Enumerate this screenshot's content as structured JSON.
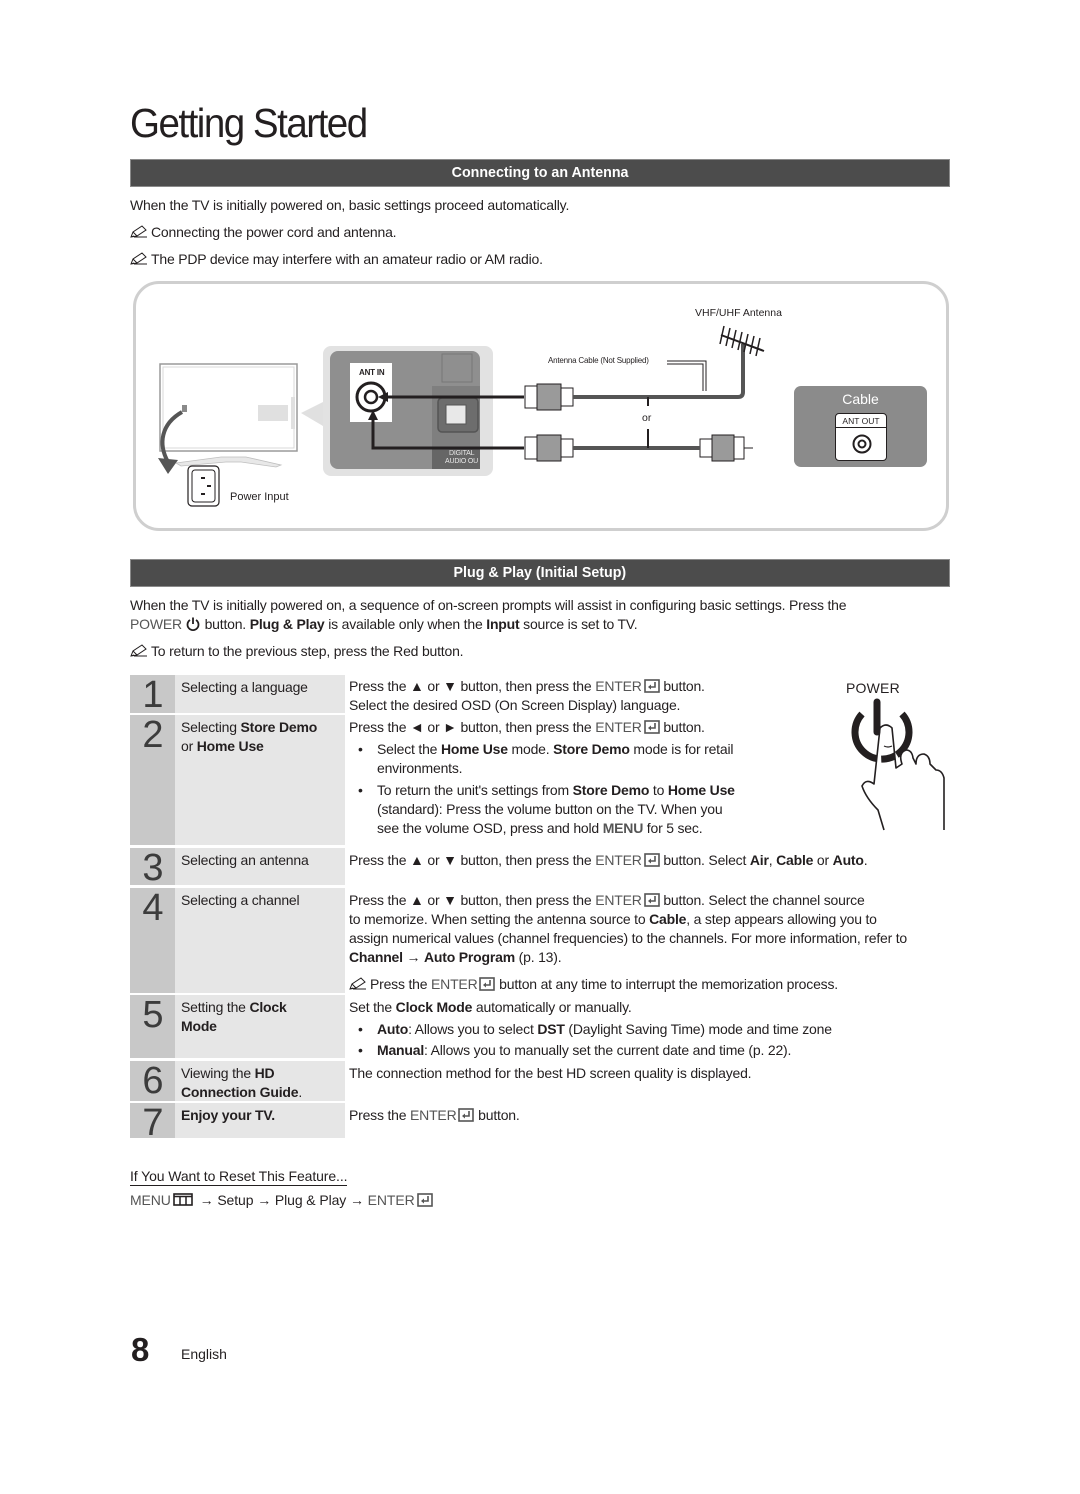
{
  "page": {
    "title": "Getting Started",
    "number": "8",
    "language": "English"
  },
  "antenna_section": {
    "header": "Connecting to an Antenna",
    "intro": "When the TV is initially powered on, basic settings proceed automatically.",
    "notes": [
      "Connecting the power cord and antenna.",
      "The PDP device may interfere with an amateur radio or AM radio."
    ],
    "diagram": {
      "vhf_uhf_antenna_label": "VHF/UHF Antenna",
      "antenna_cable_label": "Antenna Cable (Not Supplied)",
      "or_label": "or",
      "ant_in_label": "ANT IN",
      "digital_audio_label_1": "DIGITAL",
      "digital_audio_label_2": "AUDIO OU",
      "power_input_label": "Power Input",
      "cable_label": "Cable",
      "ant_out_label": "ANT OUT"
    }
  },
  "plug_play_section": {
    "header": "Plug & Play (Initial Setup)",
    "intro_line1": "When the TV is initially powered on, a sequence of on-screen prompts will assist in configuring basic settings. Press the",
    "intro_line2": {
      "power": "POWER",
      "after_power": " button. ",
      "plug_play": "Plug & Play",
      "middle": " is available only when the ",
      "input": "Input",
      "end": " source is set to TV."
    },
    "note": "To return to the previous step, press the Red button.",
    "power_label": "POWER",
    "steps": [
      {
        "number": "1",
        "title": "Selecting a language",
        "lines": [
          "Press the ▲ or ▼ button, then press the ",
          "ENTER",
          " button.",
          "Select the desired OSD (On Screen Display) language."
        ]
      },
      {
        "number": "2",
        "title_pre": "Selecting ",
        "title_b1": "Store Demo",
        "title_mid": "or ",
        "title_b2": "Home Use",
        "line1_pre": "Press the ◄ or ► button, then press the ",
        "line1_enter": "ENTER",
        "line1_post": " button.",
        "bullet1": {
          "pre": "Select the ",
          "b1": "Home Use",
          "mid": " mode. ",
          "b2": "Store Demo",
          "post": " mode is for retail",
          "line2": "environments."
        },
        "bullet2": {
          "pre": "To return the unit's settings from ",
          "b1": "Store Demo",
          "mid": " to ",
          "b2": "Home Use",
          "line2": "(standard): Press the volume button on the TV. When you",
          "line3_pre": "see the volume OSD, press and hold ",
          "line3_b": "MENU",
          "line3_post": " for 5 sec."
        }
      },
      {
        "number": "3",
        "title": "Selecting an antenna",
        "pre": "Press the ▲ or ▼ button, then press the ",
        "enter": "ENTER",
        "mid": " button. Select ",
        "b1": "Air",
        "sep1": ", ",
        "b2": "Cable",
        "sep2": " or ",
        "b3": "Auto",
        "end": "."
      },
      {
        "number": "4",
        "title": "Selecting a channel",
        "line1_pre": "Press the ▲ or ▼ button, then press the ",
        "line1_enter": "ENTER",
        "line1_post": " button. Select the channel source",
        "line2_pre": "to memorize. When setting the antenna source to ",
        "line2_b": "Cable",
        "line2_post": ", a step appears allowing you to",
        "line3": "assign numerical values (channel frequencies) to the channels. For more information, refer to",
        "line4_b1": "Channel",
        "line4_arrow": " → ",
        "line4_b2": "Auto Program",
        "line4_post": " (p. 13).",
        "note_pre": "Press the ",
        "note_enter": "ENTER",
        "note_post": " button at any time to interrupt the memorization process."
      },
      {
        "number": "5",
        "title_pre": "Setting the ",
        "title_b": "Clock",
        "title_b2": "Mode",
        "line1_pre": "Set the ",
        "line1_b": "Clock Mode",
        "line1_post": " automatically or manually.",
        "bullet1": {
          "b": "Auto",
          "pre": ": Allows you to select ",
          "b2": "DST",
          "post": " (Daylight Saving Time) mode and time zone"
        },
        "bullet2": {
          "b": "Manual",
          "post": ": Allows you to manually set the current date and time (p. 22)."
        }
      },
      {
        "number": "6",
        "title_pre": "Viewing the ",
        "title_b": "HD",
        "title_b2": "Connection Guide",
        "title_end": ".",
        "line1": "The connection method for the best HD screen quality is displayed."
      },
      {
        "number": "7",
        "title": "Enjoy your TV.",
        "pre": "Press the ",
        "enter": "ENTER",
        "post": " button."
      }
    ],
    "reset": {
      "heading": "If You Want to Reset This Feature...",
      "menu": "MENU",
      "arrow1": " → ",
      "setup": "Setup",
      "arrow2": " → ",
      "plug_play": "Plug & Play",
      "arrow3": " → ",
      "enter": "ENTER"
    }
  },
  "colors": {
    "section_bar": "#4c4c4c",
    "step_number_bg": "#c8c8c8",
    "step_title_bg": "#e6e6e6",
    "cable_box": "#8b8b8b",
    "text": "#231f20"
  }
}
